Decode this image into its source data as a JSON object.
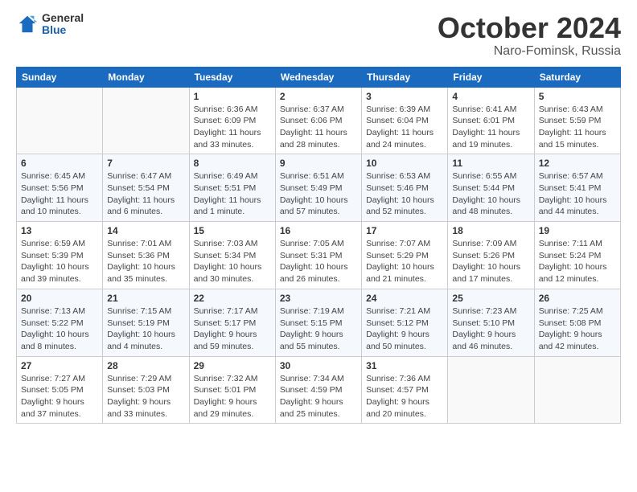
{
  "logo": {
    "general": "General",
    "blue": "Blue"
  },
  "title": {
    "month": "October 2024",
    "location": "Naro-Fominsk, Russia"
  },
  "headers": [
    "Sunday",
    "Monday",
    "Tuesday",
    "Wednesday",
    "Thursday",
    "Friday",
    "Saturday"
  ],
  "weeks": [
    [
      {
        "day": "",
        "info": ""
      },
      {
        "day": "",
        "info": ""
      },
      {
        "day": "1",
        "info": "Sunrise: 6:36 AM\nSunset: 6:09 PM\nDaylight: 11 hours\nand 33 minutes."
      },
      {
        "day": "2",
        "info": "Sunrise: 6:37 AM\nSunset: 6:06 PM\nDaylight: 11 hours\nand 28 minutes."
      },
      {
        "day": "3",
        "info": "Sunrise: 6:39 AM\nSunset: 6:04 PM\nDaylight: 11 hours\nand 24 minutes."
      },
      {
        "day": "4",
        "info": "Sunrise: 6:41 AM\nSunset: 6:01 PM\nDaylight: 11 hours\nand 19 minutes."
      },
      {
        "day": "5",
        "info": "Sunrise: 6:43 AM\nSunset: 5:59 PM\nDaylight: 11 hours\nand 15 minutes."
      }
    ],
    [
      {
        "day": "6",
        "info": "Sunrise: 6:45 AM\nSunset: 5:56 PM\nDaylight: 11 hours\nand 10 minutes."
      },
      {
        "day": "7",
        "info": "Sunrise: 6:47 AM\nSunset: 5:54 PM\nDaylight: 11 hours\nand 6 minutes."
      },
      {
        "day": "8",
        "info": "Sunrise: 6:49 AM\nSunset: 5:51 PM\nDaylight: 11 hours\nand 1 minute."
      },
      {
        "day": "9",
        "info": "Sunrise: 6:51 AM\nSunset: 5:49 PM\nDaylight: 10 hours\nand 57 minutes."
      },
      {
        "day": "10",
        "info": "Sunrise: 6:53 AM\nSunset: 5:46 PM\nDaylight: 10 hours\nand 52 minutes."
      },
      {
        "day": "11",
        "info": "Sunrise: 6:55 AM\nSunset: 5:44 PM\nDaylight: 10 hours\nand 48 minutes."
      },
      {
        "day": "12",
        "info": "Sunrise: 6:57 AM\nSunset: 5:41 PM\nDaylight: 10 hours\nand 44 minutes."
      }
    ],
    [
      {
        "day": "13",
        "info": "Sunrise: 6:59 AM\nSunset: 5:39 PM\nDaylight: 10 hours\nand 39 minutes."
      },
      {
        "day": "14",
        "info": "Sunrise: 7:01 AM\nSunset: 5:36 PM\nDaylight: 10 hours\nand 35 minutes."
      },
      {
        "day": "15",
        "info": "Sunrise: 7:03 AM\nSunset: 5:34 PM\nDaylight: 10 hours\nand 30 minutes."
      },
      {
        "day": "16",
        "info": "Sunrise: 7:05 AM\nSunset: 5:31 PM\nDaylight: 10 hours\nand 26 minutes."
      },
      {
        "day": "17",
        "info": "Sunrise: 7:07 AM\nSunset: 5:29 PM\nDaylight: 10 hours\nand 21 minutes."
      },
      {
        "day": "18",
        "info": "Sunrise: 7:09 AM\nSunset: 5:26 PM\nDaylight: 10 hours\nand 17 minutes."
      },
      {
        "day": "19",
        "info": "Sunrise: 7:11 AM\nSunset: 5:24 PM\nDaylight: 10 hours\nand 12 minutes."
      }
    ],
    [
      {
        "day": "20",
        "info": "Sunrise: 7:13 AM\nSunset: 5:22 PM\nDaylight: 10 hours\nand 8 minutes."
      },
      {
        "day": "21",
        "info": "Sunrise: 7:15 AM\nSunset: 5:19 PM\nDaylight: 10 hours\nand 4 minutes."
      },
      {
        "day": "22",
        "info": "Sunrise: 7:17 AM\nSunset: 5:17 PM\nDaylight: 9 hours\nand 59 minutes."
      },
      {
        "day": "23",
        "info": "Sunrise: 7:19 AM\nSunset: 5:15 PM\nDaylight: 9 hours\nand 55 minutes."
      },
      {
        "day": "24",
        "info": "Sunrise: 7:21 AM\nSunset: 5:12 PM\nDaylight: 9 hours\nand 50 minutes."
      },
      {
        "day": "25",
        "info": "Sunrise: 7:23 AM\nSunset: 5:10 PM\nDaylight: 9 hours\nand 46 minutes."
      },
      {
        "day": "26",
        "info": "Sunrise: 7:25 AM\nSunset: 5:08 PM\nDaylight: 9 hours\nand 42 minutes."
      }
    ],
    [
      {
        "day": "27",
        "info": "Sunrise: 7:27 AM\nSunset: 5:05 PM\nDaylight: 9 hours\nand 37 minutes."
      },
      {
        "day": "28",
        "info": "Sunrise: 7:29 AM\nSunset: 5:03 PM\nDaylight: 9 hours\nand 33 minutes."
      },
      {
        "day": "29",
        "info": "Sunrise: 7:32 AM\nSunset: 5:01 PM\nDaylight: 9 hours\nand 29 minutes."
      },
      {
        "day": "30",
        "info": "Sunrise: 7:34 AM\nSunset: 4:59 PM\nDaylight: 9 hours\nand 25 minutes."
      },
      {
        "day": "31",
        "info": "Sunrise: 7:36 AM\nSunset: 4:57 PM\nDaylight: 9 hours\nand 20 minutes."
      },
      {
        "day": "",
        "info": ""
      },
      {
        "day": "",
        "info": ""
      }
    ]
  ]
}
